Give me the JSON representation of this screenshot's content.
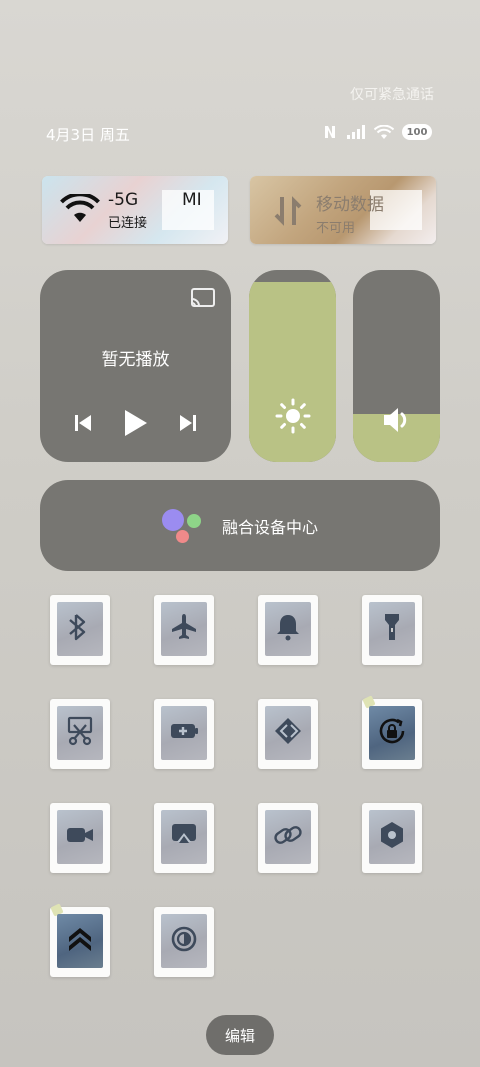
{
  "status_bar": {
    "notice": "仅可紧急通话",
    "date": "4月3日 周五",
    "battery": "100",
    "icons": [
      "nfc-icon",
      "signal-icon",
      "wifi-icon",
      "battery-icon"
    ]
  },
  "wifi_tile": {
    "title": "-5G",
    "subtitle": "已连接",
    "extra": "MI",
    "state": "on"
  },
  "mobile_tile": {
    "title": "移动数据",
    "subtitle": "不可用",
    "state": "disabled"
  },
  "media": {
    "title": "暂无播放",
    "controls": [
      "previous",
      "play",
      "next"
    ]
  },
  "brightness": {
    "level_percent": 94
  },
  "volume": {
    "level_percent": 25
  },
  "hub": {
    "label": "融合设备中心"
  },
  "toggles": [
    {
      "name": "bluetooth",
      "icon": "bluetooth-icon",
      "state": "off"
    },
    {
      "name": "airplane",
      "icon": "airplane-icon",
      "state": "off"
    },
    {
      "name": "ringer",
      "icon": "bell-icon",
      "state": "off"
    },
    {
      "name": "flashlight",
      "icon": "flashlight-icon",
      "state": "off"
    },
    {
      "name": "screenshot",
      "icon": "scissors-icon",
      "state": "off"
    },
    {
      "name": "battery-saver",
      "icon": "battery-plus-icon",
      "state": "off"
    },
    {
      "name": "shortcut",
      "icon": "shortcut-icon",
      "state": "off"
    },
    {
      "name": "rotation-lock",
      "icon": "rotation-lock-icon",
      "state": "on"
    },
    {
      "name": "screen-record",
      "icon": "video-icon",
      "state": "off"
    },
    {
      "name": "cast",
      "icon": "cast-screen-icon",
      "state": "off"
    },
    {
      "name": "link",
      "icon": "link-icon",
      "state": "off"
    },
    {
      "name": "settings",
      "icon": "hexagon-settings-icon",
      "state": "off"
    },
    {
      "name": "boost",
      "icon": "chevrons-up-icon",
      "state": "on"
    },
    {
      "name": "dark-mode",
      "icon": "contrast-icon",
      "state": "off"
    }
  ],
  "edit_label": "编辑",
  "colors": {
    "panel": "#777672",
    "accent": "#b9c285",
    "active_tile": "#4f6580"
  }
}
